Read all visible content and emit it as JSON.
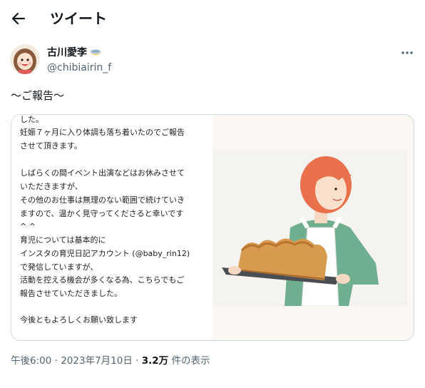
{
  "header": {
    "title": "ツイート",
    "back_icon": "arrow-left-icon"
  },
  "author": {
    "display_name": "古川愛李",
    "handle": "@chibiairin_f",
    "emoji_icon": "baby-bottle-emoji-icon"
  },
  "tweet": {
    "text": "〜ご報告〜"
  },
  "media": {
    "text_lines": [
      "した。",
      "妊娠７ヶ月に入り体調も落ち着いたのでご報告",
      "させて頂きます。",
      "",
      "しばらくの間イベント出演などはお休みさせて",
      "いただきますが、",
      "その他のお仕事は無理のない範囲で続けていき",
      "ますので、温かく見守ってくださると幸いです",
      "^ ^",
      "育児については基本的に",
      "インスタの育児日記アカウント (@baby_rin12)",
      "で発信していますが、",
      "活動を控える機会が多くなる為、こちらでもご",
      "報告させていただきました。",
      "",
      "今後ともよろしくお願い致します"
    ]
  },
  "meta": {
    "time": "午後6:00",
    "separator": "·",
    "date": "2023年7月10日",
    "view_count": "3.2万",
    "view_label": "件の表示"
  },
  "colors": {
    "secondary_text": "#536471",
    "border": "#cfd9de",
    "hair": "#e8704a",
    "shirt": "#6fae8e"
  }
}
